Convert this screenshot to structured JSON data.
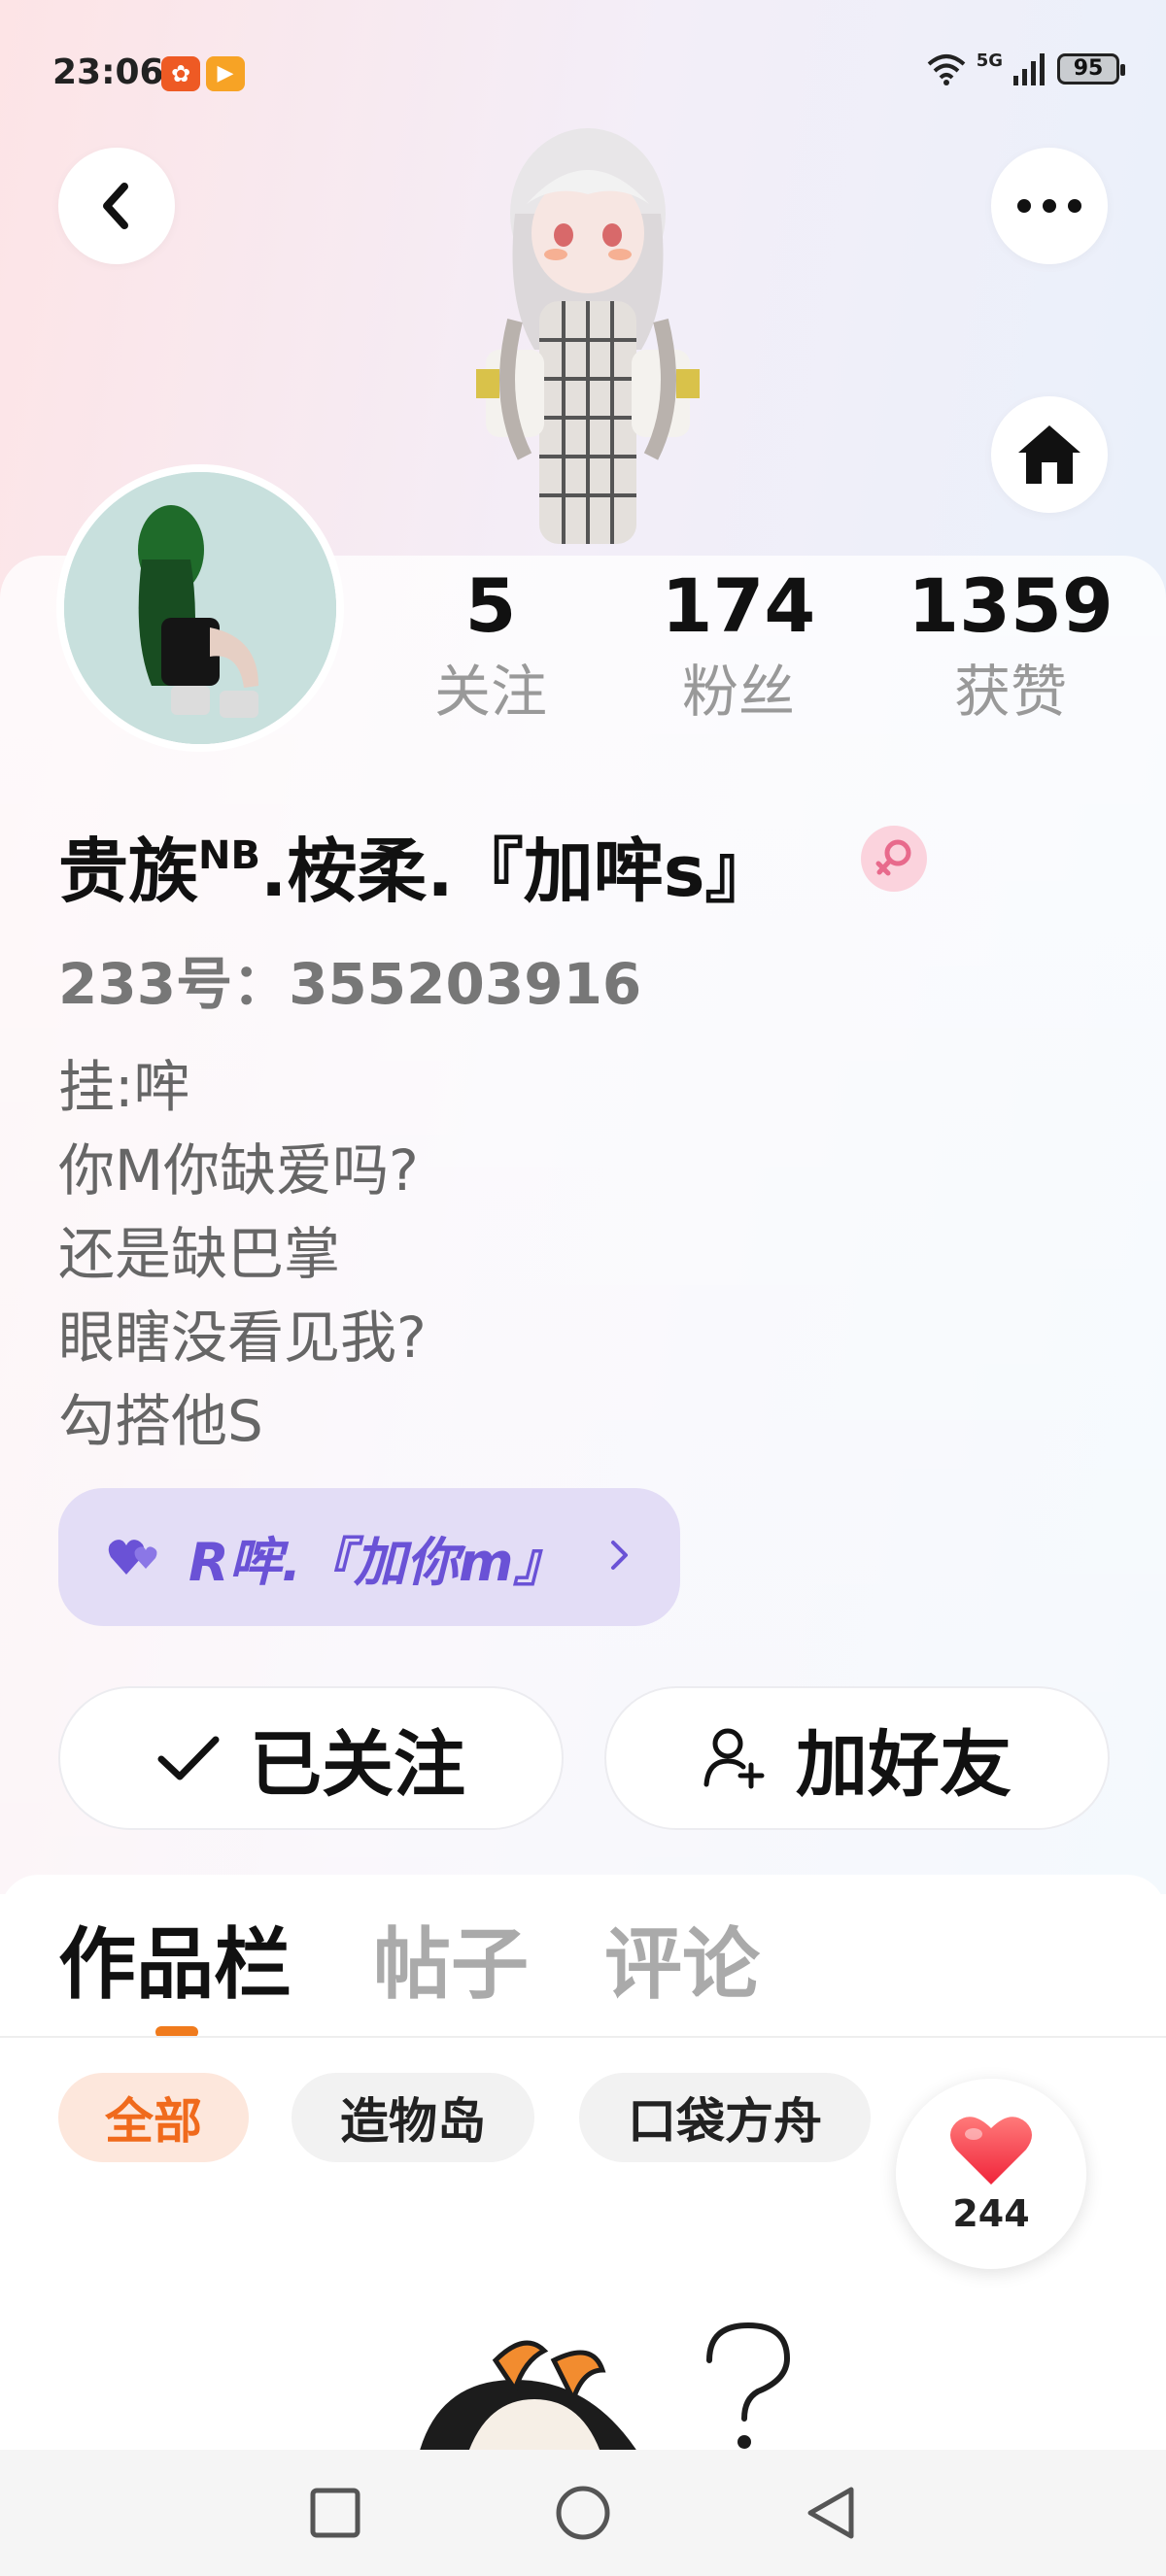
{
  "status_bar": {
    "time": "23:06",
    "network": "5G",
    "battery": "95",
    "app_icon_a": "app-notification-icon",
    "app_icon_b": "video-app-icon"
  },
  "header": {
    "back_icon": "chevron-left-icon",
    "more_icon": "more-dots-icon",
    "home_icon": "home-icon"
  },
  "profile": {
    "stats": [
      {
        "value": "5",
        "label": "关注"
      },
      {
        "value": "174",
        "label": "粉丝"
      },
      {
        "value": "1359",
        "label": "获赞"
      }
    ],
    "name_part1": "贵族",
    "name_sup": "NB",
    "name_part2": ".桉柔.『加哰s』",
    "gender": "female",
    "uid": "233号：355203916",
    "bio_lines": [
      "挂:哰",
      "你M你缺爱吗?",
      "还是缺巴掌",
      "眼瞎没看见我?",
      "勾搭他S"
    ],
    "guild_label": "R哰.『加你m』",
    "guild_color": "#6a52d6"
  },
  "actions": {
    "follow_label": "已关注",
    "add_friend_label": "加好友"
  },
  "tabs": [
    {
      "label": "作品栏",
      "active": true
    },
    {
      "label": "帖子",
      "active": false
    },
    {
      "label": "评论",
      "active": false
    }
  ],
  "filters": [
    {
      "label": "全部",
      "active": true
    },
    {
      "label": "造物岛",
      "active": false
    },
    {
      "label": "口袋方舟",
      "active": false
    }
  ],
  "likes": {
    "count": "244"
  },
  "accent_color": "#f07b1d",
  "nav": [
    "recent-apps-icon",
    "home-circle-icon",
    "back-triangle-icon"
  ]
}
